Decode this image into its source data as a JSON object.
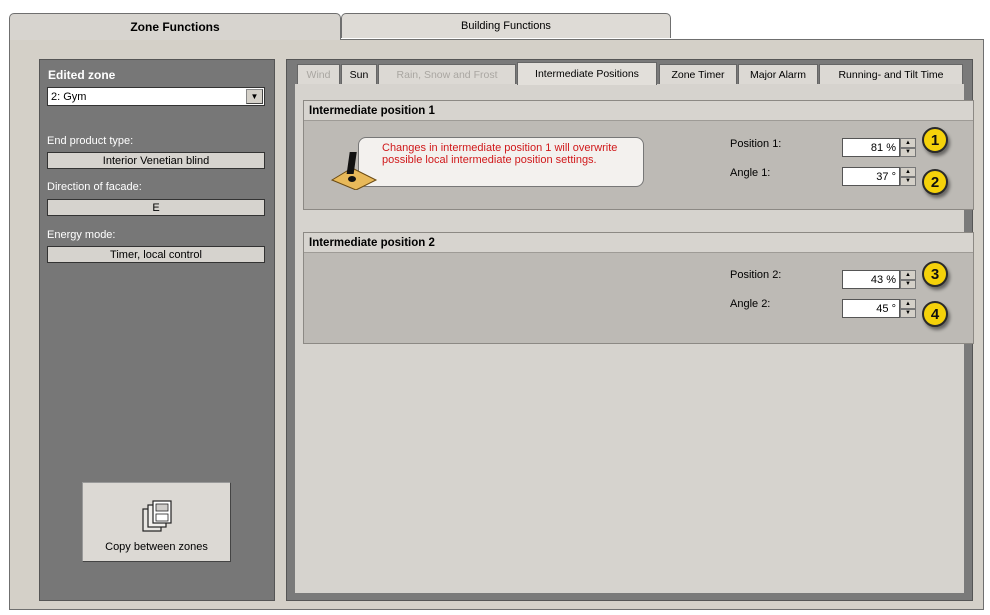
{
  "tabs": {
    "zone_functions": "Zone Functions",
    "building_functions": "Building Functions"
  },
  "left": {
    "edited_zone_title": "Edited zone",
    "zone_selected": "2: Gym",
    "end_product_label": "End product type:",
    "end_product_value": "Interior Venetian blind",
    "direction_label": "Direction of facade:",
    "direction_value": "E",
    "energy_label": "Energy mode:",
    "energy_value": "Timer, local control",
    "copy_button_label": "Copy between zones"
  },
  "subtabs": [
    {
      "label": "Wind",
      "state": "disabled"
    },
    {
      "label": "Sun",
      "state": "enabled"
    },
    {
      "label": "Rain, Snow and Frost",
      "state": "disabled"
    },
    {
      "label": "Intermediate Positions",
      "state": "active"
    },
    {
      "label": "Zone Timer",
      "state": "enabled"
    },
    {
      "label": "Major Alarm",
      "state": "enabled"
    },
    {
      "label": "Running- and Tilt Time",
      "state": "enabled"
    }
  ],
  "group1": {
    "title": "Intermediate position 1",
    "warning": "Changes in intermediate position 1 will overwrite possible local intermediate position settings.",
    "position_label": "Position 1:",
    "position_value": "81 %",
    "angle_label": "Angle 1:",
    "angle_value": "37 °"
  },
  "group2": {
    "title": "Intermediate position 2",
    "position_label": "Position 2:",
    "position_value": "43 %",
    "angle_label": "Angle 2:",
    "angle_value": "45 °"
  },
  "markers": [
    "1",
    "2",
    "3",
    "4"
  ],
  "colors": {
    "warning_text": "#d0191b",
    "marker_fill": "#f5d20a",
    "panel_gray": "#777777"
  }
}
